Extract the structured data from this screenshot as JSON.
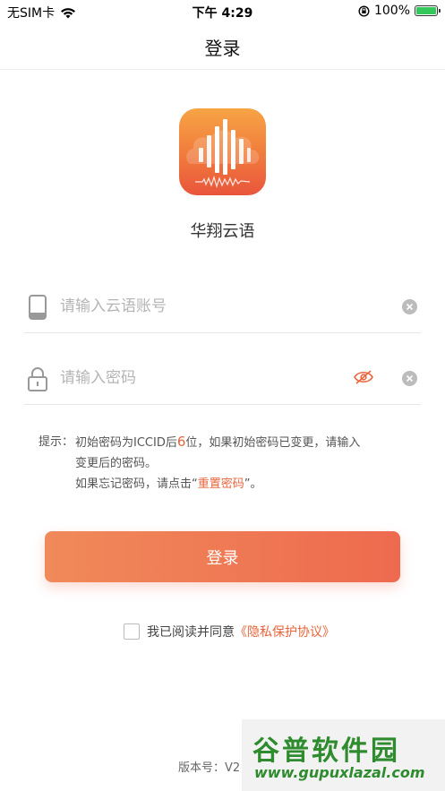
{
  "status_bar": {
    "carrier": "无SIM卡",
    "time": "下午 4:29",
    "battery": "100%"
  },
  "nav": {
    "title": "登录"
  },
  "app": {
    "name": "华翔云语"
  },
  "form": {
    "account_placeholder": "请输入云语账号",
    "password_placeholder": "请输入密码"
  },
  "hint": {
    "label": "提示：",
    "line1_pre": "初始密码为ICCID后",
    "line1_num": "6",
    "line1_post": "位，如果初始密码已变更，请输入",
    "line2": "变更后的密码。",
    "line3_pre": "如果忘记密码，请点击“",
    "line3_link": "重置密码",
    "line3_post": "”。"
  },
  "login_button": "登录",
  "agreement": {
    "text": "我已阅读并同意",
    "link": "《隐私保护协议》"
  },
  "version": "版本号：V2",
  "watermark": {
    "title": "谷普软件园",
    "url": "www.gupuxlazal.com"
  },
  "colors": {
    "accent": "#e8643a",
    "button_start": "#f08a5a",
    "button_end": "#ee6a4f"
  }
}
